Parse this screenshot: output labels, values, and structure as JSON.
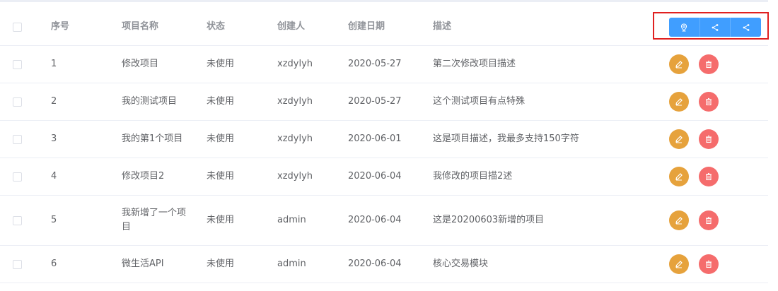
{
  "colors": {
    "primary": "#409eff",
    "warning": "#e6a23c",
    "danger": "#f56c6c",
    "highlight_border": "#e02020"
  },
  "table": {
    "headers": {
      "index": "序号",
      "name": "项目名称",
      "status": "状态",
      "creator": "创建人",
      "created_date": "创建日期",
      "description": "描述"
    },
    "toolbar_icons": [
      "location-icon",
      "share-icon",
      "share-icon"
    ],
    "rows": [
      {
        "index": "1",
        "name": "修改项目",
        "status": "未使用",
        "creator": "xzdylyh",
        "created_date": "2020-05-27",
        "description": "第二次修改项目描述"
      },
      {
        "index": "2",
        "name": "我的测试项目",
        "status": "未使用",
        "creator": "xzdylyh",
        "created_date": "2020-05-27",
        "description": "这个测试项目有点特殊"
      },
      {
        "index": "3",
        "name": "我的第1个项目",
        "status": "未使用",
        "creator": "xzdylyh",
        "created_date": "2020-06-01",
        "description": "这是项目描述，我最多支持150字符"
      },
      {
        "index": "4",
        "name": "修改项目2",
        "status": "未使用",
        "creator": "xzdylyh",
        "created_date": "2020-06-04",
        "description": "我修改的项目描2述"
      },
      {
        "index": "5",
        "name": "我新增了一个项目",
        "status": "未使用",
        "creator": "admin",
        "created_date": "2020-06-04",
        "description": "这是20200603新增的项目"
      },
      {
        "index": "6",
        "name": "微生活API",
        "status": "未使用",
        "creator": "admin",
        "created_date": "2020-06-04",
        "description": "核心交易模块"
      }
    ],
    "row_action_icons": [
      "edit-icon",
      "delete-icon"
    ]
  }
}
